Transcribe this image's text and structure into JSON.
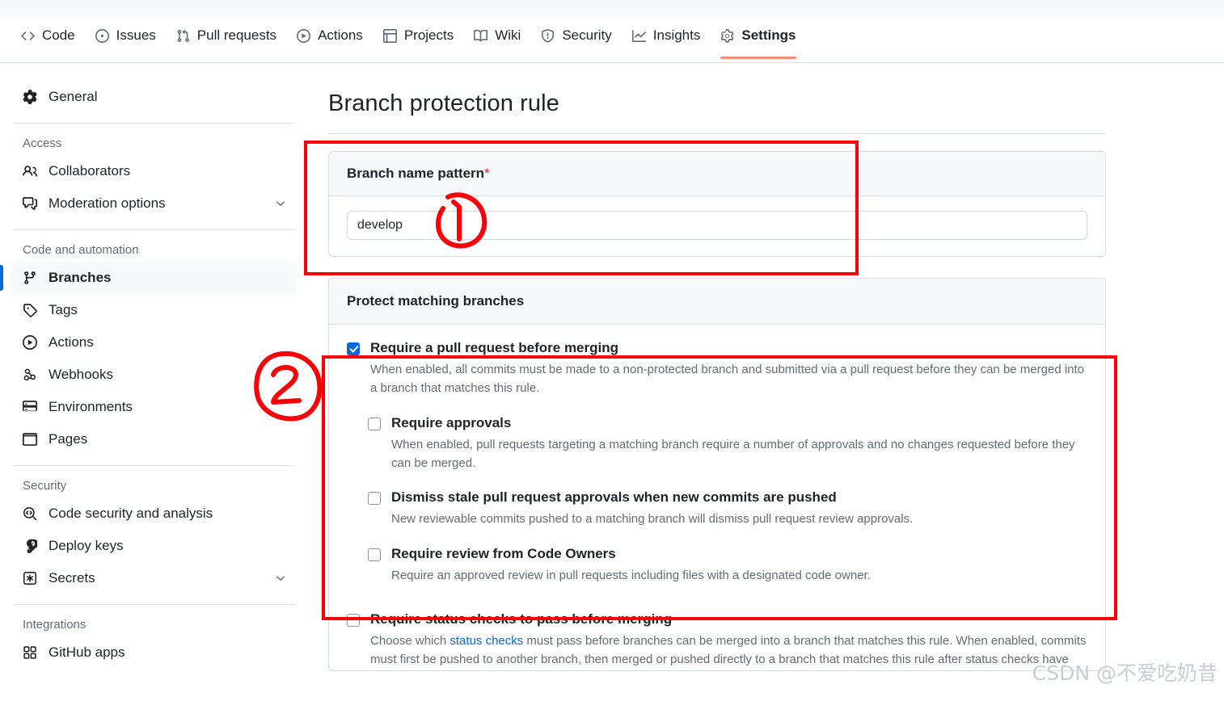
{
  "repo_nav": {
    "items": [
      {
        "label": "Code",
        "icon": "code-icon",
        "active": false
      },
      {
        "label": "Issues",
        "icon": "issue-opened-icon",
        "active": false
      },
      {
        "label": "Pull requests",
        "icon": "git-pull-request-icon",
        "active": false
      },
      {
        "label": "Actions",
        "icon": "play-icon",
        "active": false
      },
      {
        "label": "Projects",
        "icon": "table-icon",
        "active": false
      },
      {
        "label": "Wiki",
        "icon": "book-icon",
        "active": false
      },
      {
        "label": "Security",
        "icon": "shield-icon",
        "active": false
      },
      {
        "label": "Insights",
        "icon": "graph-icon",
        "active": false
      },
      {
        "label": "Settings",
        "icon": "gear-icon",
        "active": true
      }
    ]
  },
  "sidebar": {
    "general": {
      "label": "General",
      "icon": "gear-icon"
    },
    "sections": [
      {
        "heading": "Access",
        "items": [
          {
            "label": "Collaborators",
            "icon": "people-icon",
            "chevron": false
          },
          {
            "label": "Moderation options",
            "icon": "comment-discussion-icon",
            "chevron": true
          }
        ]
      },
      {
        "heading": "Code and automation",
        "items": [
          {
            "label": "Branches",
            "icon": "git-branch-icon",
            "chevron": false,
            "active": true
          },
          {
            "label": "Tags",
            "icon": "tag-icon",
            "chevron": false
          },
          {
            "label": "Actions",
            "icon": "play-icon",
            "chevron": false
          },
          {
            "label": "Webhooks",
            "icon": "webhook-icon",
            "chevron": false
          },
          {
            "label": "Environments",
            "icon": "server-icon",
            "chevron": false
          },
          {
            "label": "Pages",
            "icon": "browser-icon",
            "chevron": false
          }
        ]
      },
      {
        "heading": "Security",
        "items": [
          {
            "label": "Code security and analysis",
            "icon": "codescan-icon",
            "chevron": false
          },
          {
            "label": "Deploy keys",
            "icon": "key-icon",
            "chevron": false
          },
          {
            "label": "Secrets",
            "icon": "asterisk-box-icon",
            "chevron": true
          }
        ]
      },
      {
        "heading": "Integrations",
        "items": [
          {
            "label": "GitHub apps",
            "icon": "apps-icon",
            "chevron": false
          }
        ]
      }
    ]
  },
  "main": {
    "page_title": "Branch protection rule",
    "branch_pattern": {
      "label": "Branch name pattern",
      "required_marker": "*",
      "value": "develop",
      "placeholder": ""
    },
    "protect_section": {
      "heading": "Protect matching branches",
      "rules": [
        {
          "title": "Require a pull request before merging",
          "checked": true,
          "desc": "When enabled, all commits must be made to a non-protected branch and submitted via a pull request before they can be merged into a branch that matches this rule."
        },
        {
          "title": "Require approvals",
          "checked": false,
          "desc": "When enabled, pull requests targeting a matching branch require a number of approvals and no changes requested before they can be merged."
        },
        {
          "title": "Dismiss stale pull request approvals when new commits are pushed",
          "checked": false,
          "desc": "New reviewable commits pushed to a matching branch will dismiss pull request review approvals."
        },
        {
          "title": "Require review from Code Owners",
          "checked": false,
          "desc": "Require an approved review in pull requests including files with a designated code owner."
        },
        {
          "title": "Require status checks to pass before merging",
          "checked": false,
          "desc_before_link": "Choose which ",
          "desc_link": "status checks",
          "desc_after_link": " must pass before branches can be merged into a branch that matches this rule. When enabled, commits must first be pushed to another branch, then merged or pushed directly to a branch that matches this rule after status checks have"
        }
      ]
    }
  },
  "annotations": {
    "marker_one": "1",
    "marker_two": "2",
    "color": "#fb0007"
  },
  "watermark": {
    "text": "CSDN @不爱吃奶昔"
  }
}
